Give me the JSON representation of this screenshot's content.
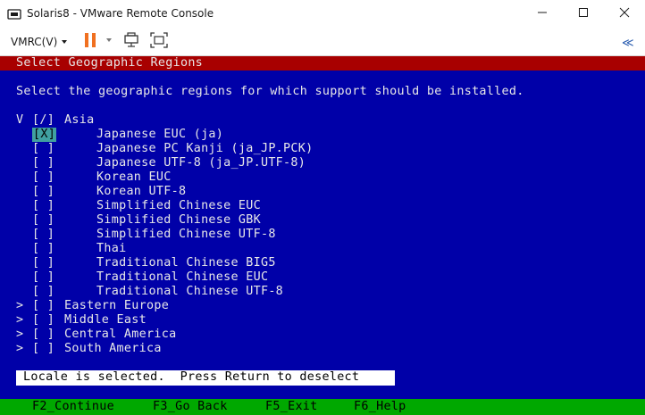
{
  "window": {
    "title": "Solaris8 - VMware Remote Console"
  },
  "toolbar": {
    "vmrc_menu_label": "VMRC(V)",
    "pause_color": "#f07020",
    "collapse_glyph": "≪"
  },
  "console": {
    "header": "Select Geographic Regions",
    "instruction": "Select the geographic regions for which support should be installed.",
    "tree": [
      {
        "arrow": "V",
        "checkbox": "[/]",
        "label": "Asia",
        "level": 1,
        "selected": false
      },
      {
        "arrow": "",
        "checkbox": "[X]",
        "label": "Japanese EUC (ja)",
        "level": 2,
        "selected": true
      },
      {
        "arrow": "",
        "checkbox": "[ ]",
        "label": "Japanese PC Kanji (ja_JP.PCK)",
        "level": 2,
        "selected": false
      },
      {
        "arrow": "",
        "checkbox": "[ ]",
        "label": "Japanese UTF-8 (ja_JP.UTF-8)",
        "level": 2,
        "selected": false
      },
      {
        "arrow": "",
        "checkbox": "[ ]",
        "label": "Korean EUC",
        "level": 2,
        "selected": false
      },
      {
        "arrow": "",
        "checkbox": "[ ]",
        "label": "Korean UTF-8",
        "level": 2,
        "selected": false
      },
      {
        "arrow": "",
        "checkbox": "[ ]",
        "label": "Simplified Chinese EUC",
        "level": 2,
        "selected": false
      },
      {
        "arrow": "",
        "checkbox": "[ ]",
        "label": "Simplified Chinese GBK",
        "level": 2,
        "selected": false
      },
      {
        "arrow": "",
        "checkbox": "[ ]",
        "label": "Simplified Chinese UTF-8",
        "level": 2,
        "selected": false
      },
      {
        "arrow": "",
        "checkbox": "[ ]",
        "label": "Thai",
        "level": 2,
        "selected": false
      },
      {
        "arrow": "",
        "checkbox": "[ ]",
        "label": "Traditional Chinese BIG5",
        "level": 2,
        "selected": false
      },
      {
        "arrow": "",
        "checkbox": "[ ]",
        "label": "Traditional Chinese EUC",
        "level": 2,
        "selected": false
      },
      {
        "arrow": "",
        "checkbox": "[ ]",
        "label": "Traditional Chinese UTF-8",
        "level": 2,
        "selected": false
      },
      {
        "arrow": ">",
        "checkbox": "[ ]",
        "label": "Eastern Europe",
        "level": 1,
        "selected": false
      },
      {
        "arrow": ">",
        "checkbox": "[ ]",
        "label": "Middle East",
        "level": 1,
        "selected": false
      },
      {
        "arrow": ">",
        "checkbox": "[ ]",
        "label": "Central America",
        "level": 1,
        "selected": false
      },
      {
        "arrow": ">",
        "checkbox": "[ ]",
        "label": "South America",
        "level": 1,
        "selected": false
      }
    ],
    "status": "Locale is selected.  Press Return to deselect",
    "function_keys": [
      {
        "label": "F2_Continue"
      },
      {
        "label": "F3_Go Back"
      },
      {
        "label": "F5_Exit"
      },
      {
        "label": "F6_Help"
      }
    ],
    "colors": {
      "background": "#0000a8",
      "header_bar": "#a80000",
      "footer_bar": "#00a800",
      "selected_checkbox": "#40a0a0"
    }
  }
}
